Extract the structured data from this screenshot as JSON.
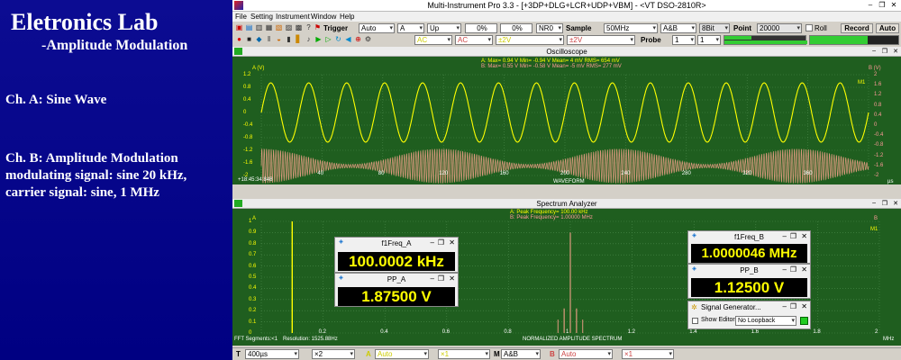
{
  "slide": {
    "title": "Eletronics Lab",
    "subtitle": "-Amplitude Modulation",
    "ch_a": "Ch. A: Sine Wave",
    "ch_b_1": "Ch. B: Amplitude Modulation",
    "ch_b_2": "modulating signal: sine 20 kHz,",
    "ch_b_3": "carrier signal: sine, 1 MHz"
  },
  "window": {
    "title": "Multi-Instrument Pro 3.3    -   [+3DP+DLG+LCR+UDP+VBM]   -   <VT DSO-2810R>",
    "menu": [
      "File",
      "Setting",
      "Instrument",
      "Window",
      "Help"
    ]
  },
  "toolbar1": {
    "trigger_label": "Trigger",
    "trigger_mode": "Auto",
    "trigger_channel": "A",
    "trigger_edge": "Up",
    "pct1": "0%",
    "pct2": "0%",
    "nr": "NR0",
    "sample_label": "Sample",
    "sample_rate": "50MHz",
    "channels": "A&B",
    "bits": "8Bit",
    "point_label": "Point",
    "points": "20000",
    "roll_label": "Roll",
    "record_label": "Record",
    "auto_label": "Auto"
  },
  "toolbar2": {
    "mode_a": "AC",
    "mode_b": "AC",
    "range_a": "±2V",
    "range_b": "±2V",
    "probe_label": "Probe",
    "probe_a": "1",
    "probe_b": "1"
  },
  "oscilloscope": {
    "title": "Oscilloscope",
    "stats_a": "A: Max=      0.94   V  Min=     -0.94   V  Mean=             4 mV  RMS=      654 mV",
    "stats_b": "B: Max=      0.55   V  Min=     -0.58   V  Mean=            -5 mV  RMS=      277 mV",
    "left_unit": "A (V)",
    "right_unit": "B (V)",
    "y_ticks_a": [
      "1.2",
      "0.8",
      "0.4",
      "0",
      "-0.4",
      "-0.8",
      "-1.2",
      "-1.6",
      "-2"
    ],
    "y_ticks_b": [
      "2",
      "1.6",
      "1.2",
      "0.8",
      "0.4",
      "0",
      "-0.4",
      "-0.8",
      "-1.2",
      "-1.6",
      "-2"
    ],
    "x_ticks": [
      "40",
      "80",
      "120",
      "160",
      "200",
      "240",
      "280",
      "320",
      "360"
    ],
    "x_start": "+18:45:34:848",
    "x_unit": "µs",
    "x_label": "WAVEFORM",
    "right_tag": "M1"
  },
  "spectrum": {
    "title": "Spectrum Analyzer",
    "peak_a": "A: Peak Frequency=      100.00   kHz",
    "peak_b": "B: Peak Frequency=    1.00000   MHz",
    "left_unit": "A",
    "right_unit": "B",
    "y_ticks": [
      "1",
      "0.9",
      "0.8",
      "0.7",
      "0.6",
      "0.5",
      "0.4",
      "0.3",
      "0.2",
      "0.1",
      "0"
    ],
    "x_ticks": [
      "0.2",
      "0.4",
      "0.6",
      "0.8",
      "1",
      "1.2",
      "1.4",
      "1.6",
      "1.8",
      "2"
    ],
    "x_unit": "MHz",
    "x_label": "NORMALIZED AMPLITUDE SPECTRUM",
    "fft_segments": "FFT Segments:<1",
    "resolution": "Resolution:  1525.88Hz",
    "right_tag": "M1"
  },
  "meters": {
    "f1freq_a": {
      "name": "f1Freq_A",
      "value": "100.0002 kHz"
    },
    "pp_a": {
      "name": "PP_A",
      "value": "1.87500 V"
    },
    "f1freq_b": {
      "name": "f1Freq_B",
      "value": "1.0000046 MHz"
    },
    "pp_b": {
      "name": "PP_B",
      "value": "1.12500 V"
    }
  },
  "siggen": {
    "title": "Signal Generator...",
    "show_editor": "Show Editor",
    "loopback": "No Loopback"
  },
  "bottombar": {
    "t_label": "T",
    "timebase": "400µs",
    "t_mult": "×2",
    "a_label": "A",
    "a_val": "Auto",
    "a_mult": "×1",
    "m_label": "M",
    "m_val": "A&B",
    "b_label": "B",
    "b_val": "Auto",
    "b_mult": "×1"
  },
  "colors": {
    "plot_bg": "#1f5e1f",
    "grid": "#4c8a4c",
    "ch_a": "#ffff00",
    "ch_b": "#e09a80"
  }
}
